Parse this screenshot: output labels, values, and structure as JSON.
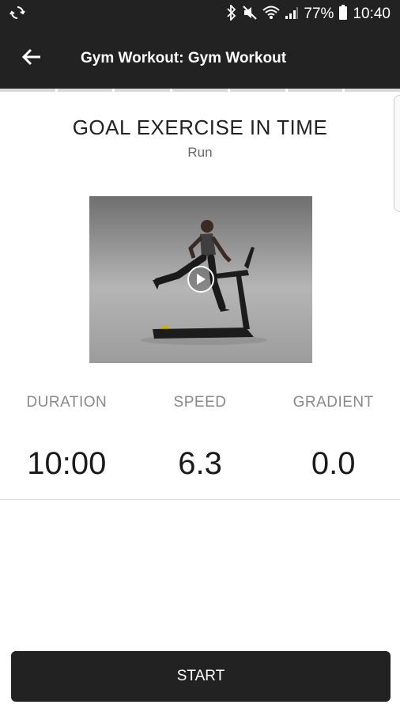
{
  "status_bar": {
    "battery": "77%",
    "time": "10:40",
    "icons": [
      "sync-icon",
      "bluetooth-icon",
      "mute-icon",
      "wifi-icon",
      "signal-icon",
      "battery-icon"
    ]
  },
  "app_bar": {
    "title": "Gym Workout: Gym Workout",
    "back_icon": "arrow-left-icon"
  },
  "exercise": {
    "title": "GOAL EXERCISE IN TIME",
    "subtitle": "Run"
  },
  "metrics": [
    {
      "label": "DURATION",
      "value": "10:00"
    },
    {
      "label": "SPEED",
      "value": "6.3"
    },
    {
      "label": "GRADIENT",
      "value": "0.0"
    }
  ],
  "actions": {
    "start_label": "START"
  },
  "colors": {
    "bar_bg": "#222222",
    "page_bg": "#ffffff",
    "label_gray": "#888888"
  }
}
